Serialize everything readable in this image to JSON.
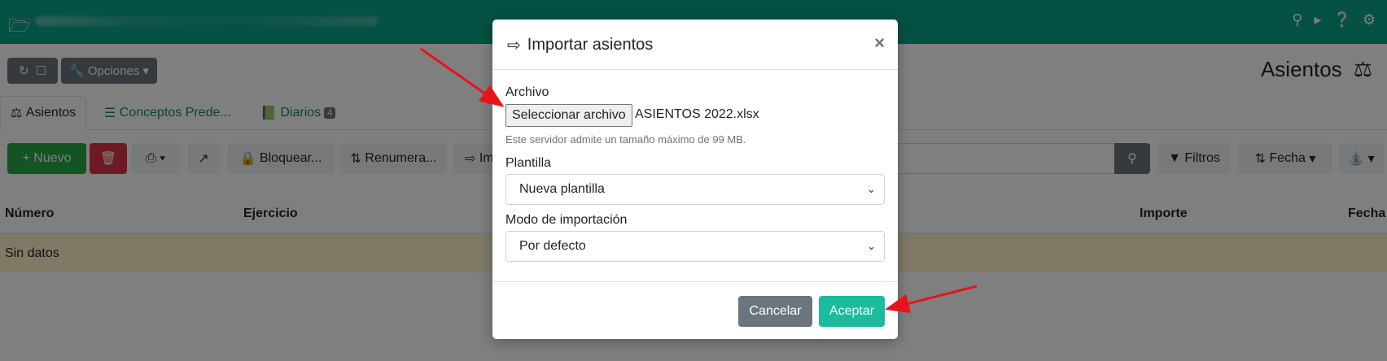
{
  "background": {
    "toolbar": {
      "options_label": "Opciones"
    },
    "page_title": "Asientos",
    "tabs": [
      {
        "label": "Asientos"
      },
      {
        "label": "Conceptos Prede..."
      },
      {
        "label": "Diarios",
        "badge": "4"
      }
    ],
    "actions": {
      "new_label": "Nuevo",
      "lock_label": "Bloquear...",
      "renumber_label": "Renumera...",
      "import_label": "Im",
      "filters_label": "Filtros",
      "sort_label": "Fecha"
    },
    "table": {
      "columns": [
        "Número",
        "Ejercicio",
        "Importe",
        "Fecha"
      ],
      "empty_text": "Sin datos"
    }
  },
  "modal": {
    "title": "Importar asientos",
    "close_glyph": "×",
    "file": {
      "label": "Archivo",
      "button_label": "Seleccionar archivo",
      "file_name": "ASIENTOS 2022.xlsx",
      "help": "Este servidor admite un tamaño máximo de 99 MB."
    },
    "template": {
      "label": "Plantilla",
      "selected": "Nueva plantilla"
    },
    "mode": {
      "label": "Modo de importación",
      "selected": "Por defecto"
    },
    "cancel_label": "Cancelar",
    "accept_label": "Aceptar"
  },
  "colors": {
    "topbar": "#0aa286",
    "accept": "#1abc9c",
    "cancel": "#6c757d",
    "arrow": "#e8141b",
    "empty_row": "#fff3cd"
  }
}
